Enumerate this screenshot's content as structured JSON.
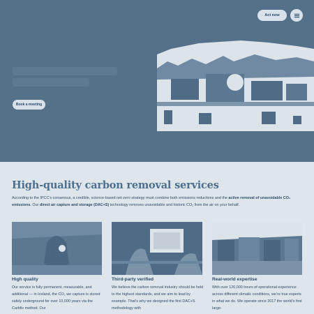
{
  "header": {
    "cta_label": "Act now",
    "menu_icon": "hamburger-menu-icon"
  },
  "hero": {
    "button_label": "Book a meeting"
  },
  "services": {
    "title": "High-quality carbon removal services",
    "intro_part1": "According to the IPCC’s consensus, a credible, science-based net-zero strategy must combine both emissions reductions and the ",
    "intro_bold1": "active removal of unavoidable CO₂ emissions",
    "intro_part2": ". Our ",
    "intro_bold2": "direct air capture and storage (DAC+S)",
    "intro_part3": " technology removes unavoidable and historic CO₂ from the air on your behalf.",
    "cards": [
      {
        "title": "High quality",
        "text": "Our service is fully permanent, measurable, and additional — in Iceland, the CO₂ we capture is stored safely underground for over 10,000 years via the Carbfix method. Our"
      },
      {
        "title": "Third-party verified",
        "text": "We believe the carbon removal industry should be held to the highest standards, and we aim to lead by example. That’s why we designed the first DAC+S methodology with"
      },
      {
        "title": "Real-world expertise",
        "text": "With over 120,000 hours of operational experience across different climatic conditions, we’re true experts in what we do. We operate since 2017 the world’s first large-"
      }
    ]
  },
  "colors": {
    "hero_bg": "#557089",
    "page_bg": "#dfe6eb",
    "title": "#4f6f8e",
    "text": "#2e4b69",
    "pill": "#d9e2ea"
  }
}
